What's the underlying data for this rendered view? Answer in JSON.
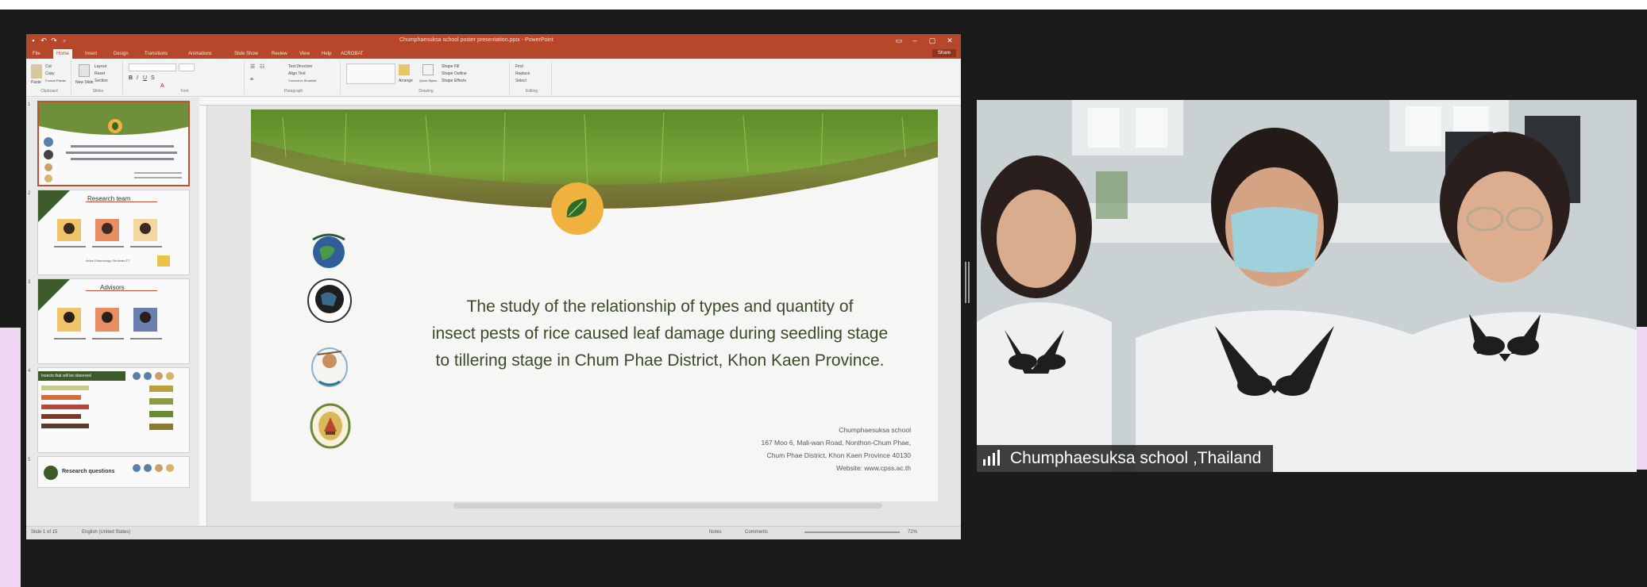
{
  "powerpoint": {
    "document_title": "Chumphaesuksa school poster presentation.pptx - PowerPoint",
    "tabs": [
      "File",
      "Home",
      "Insert",
      "Design",
      "Transitions",
      "Animations",
      "Slide Show",
      "Review",
      "View",
      "Help",
      "ACROBAT"
    ],
    "active_tab": "Home",
    "share_label": "Share",
    "ribbon_groups": [
      "Clipboard",
      "Slides",
      "Font",
      "Paragraph",
      "Drawing",
      "Editing"
    ],
    "ribbon": {
      "cut": "Cut",
      "copy": "Copy",
      "format_painter": "Format Painter",
      "paste": "Paste",
      "new_slide": "New Slide",
      "layout": "Layout",
      "reset": "Reset",
      "section": "Section",
      "text_direction": "Text Direction",
      "align_text": "Align Text",
      "convert_smartart": "Convert to SmartArt",
      "arrange": "Arrange",
      "quick_styles": "Quick Styles",
      "shape_fill": "Shape Fill",
      "shape_outline": "Shape Outline",
      "shape_effects": "Shape Effects",
      "find": "Find",
      "replace": "Replace",
      "select": "Select"
    },
    "thumbnails": [
      {
        "num": "1",
        "title": "",
        "caption": ""
      },
      {
        "num": "2",
        "title": "Research team",
        "caption": "Asian Entomology Students ET"
      },
      {
        "num": "3",
        "title": "Advisors",
        "caption": ""
      },
      {
        "num": "4",
        "title": "Insects that will be observed",
        "caption": ""
      },
      {
        "num": "5",
        "title": "Research questions",
        "caption": ""
      }
    ],
    "status": {
      "slide_info": "Slide 1 of 15",
      "language": "English (United States)",
      "notes": "Notes",
      "comments": "Comments",
      "zoom": "72%"
    }
  },
  "slide": {
    "title_lines": [
      "The study of the relationship of types and quantity of",
      "insect pests of rice caused leaf damage during seedling stage",
      "to tillering stage in Chum Phae District, Khon Kaen Province."
    ],
    "contact_lines": [
      "Chumphaesuksa school",
      "167 Moo 6, Mali-wan Road, Nonthon-Chum Phae,",
      "Chum Phae District, Khon Kaen Province 40130",
      "Website: www.cpss.ac.th"
    ],
    "logos": [
      "the-globe-program-logo",
      "globe-thailand-logo",
      "teacher-network-logo",
      "school-emblem-logo"
    ]
  },
  "video": {
    "participant_label": "Chumphaesuksa school ,Thailand",
    "signal_icon": "signal-strength-icon"
  },
  "colors": {
    "ppt_accent": "#b7472a",
    "slide_title": "#3a4a2a",
    "leaf_badge": "#f0b23f"
  }
}
